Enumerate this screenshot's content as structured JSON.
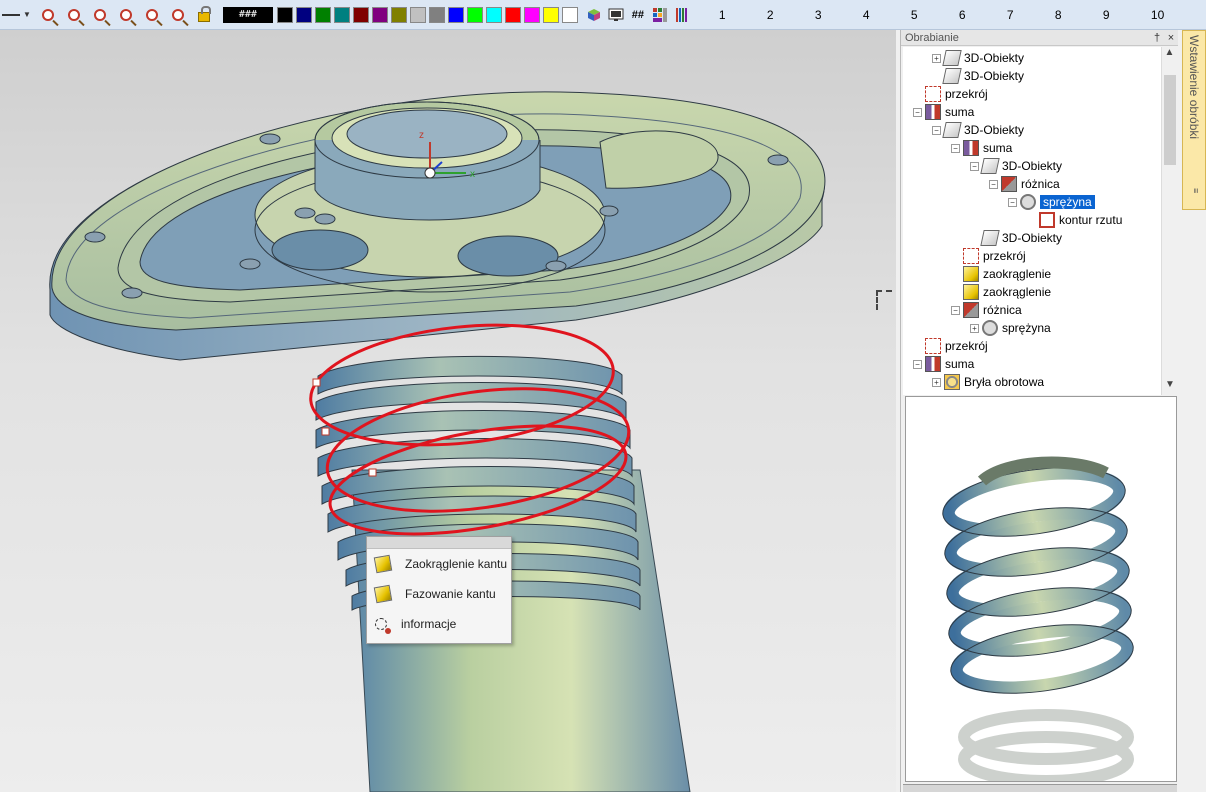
{
  "toolbar": {
    "color_hash_label": "###",
    "swatches": [
      "#000000",
      "#000080",
      "#008000",
      "#008080",
      "#800000",
      "#800080",
      "#808000",
      "#c0c0c0",
      "#808080",
      "#0000ff",
      "#00ff00",
      "#00ffff",
      "#ff0000",
      "#ff00ff",
      "#ffff00",
      "#ffffff"
    ],
    "grid_label": "##",
    "ruler_numbers": [
      "1",
      "2",
      "3",
      "4",
      "5",
      "6",
      "7",
      "8",
      "9",
      "10"
    ]
  },
  "viewport": {
    "axis_z": "z",
    "axis_x": "x"
  },
  "context_menu": {
    "items": [
      "Zaokrąglenie kantu",
      "Fazowanie kantu",
      "informacje"
    ]
  },
  "panel": {
    "title": "Obrabianie",
    "pin": "†",
    "close": "×",
    "side_tab": "Wstawienie obróbki",
    "tree": [
      {
        "label": "3D-Obiekty",
        "icon": "box"
      },
      {
        "label": "3D-Obiekty",
        "icon": "box"
      },
      {
        "label": "przekrój",
        "icon": "section"
      },
      {
        "label": "suma",
        "icon": "sum"
      },
      {
        "label": "3D-Obiekty",
        "icon": "box"
      },
      {
        "label": "suma",
        "icon": "sum"
      },
      {
        "label": "3D-Obiekty",
        "icon": "box"
      },
      {
        "label": "różnica",
        "icon": "difference"
      },
      {
        "label": "sprężyna",
        "icon": "spring",
        "selected": true
      },
      {
        "label": "kontur rzutu",
        "icon": "contour"
      },
      {
        "label": "3D-Obiekty",
        "icon": "box"
      },
      {
        "label": "przekrój",
        "icon": "section"
      },
      {
        "label": "zaokrąglenie",
        "icon": "round"
      },
      {
        "label": "zaokrąglenie",
        "icon": "round"
      },
      {
        "label": "różnica",
        "icon": "difference"
      },
      {
        "label": "sprężyna",
        "icon": "spring"
      },
      {
        "label": "przekrój",
        "icon": "section"
      },
      {
        "label": "suma",
        "icon": "sum"
      },
      {
        "label": "Bryła obrotowa",
        "icon": "revolve"
      }
    ]
  }
}
